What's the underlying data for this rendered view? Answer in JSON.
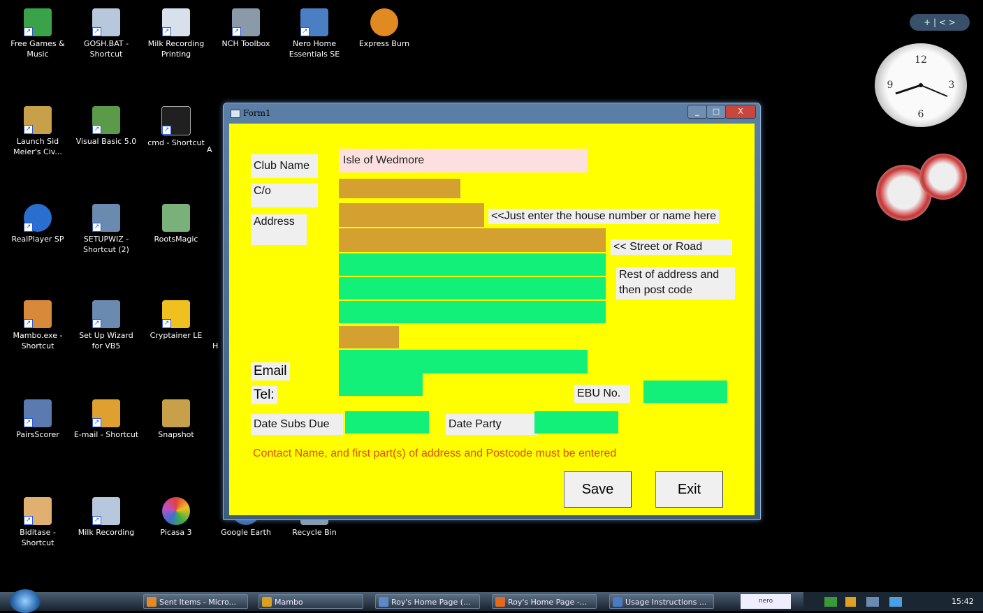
{
  "desktop_icons": [
    {
      "label": "Free Games & Music",
      "color": "#3aa34a"
    },
    {
      "label": "GOSH.BAT - Shortcut",
      "color": "#b8c8dc"
    },
    {
      "label": "Milk Recording Printing",
      "color": "#d8e0ec"
    },
    {
      "label": "NCH Toolbox",
      "color": "#8a9aa8"
    },
    {
      "label": "Nero Home Essentials SE",
      "color": "#4a7fc4"
    },
    {
      "label": "Express Burn",
      "color": "#e28a22"
    },
    {
      "label": "Launch Sid Meier's Civ...",
      "color": "#c9a04a"
    },
    {
      "label": "Visual Basic 5.0",
      "color": "#5a9a48"
    },
    {
      "label": "cmd - Shortcut",
      "color": "#202020"
    },
    {
      "label": "RealPlayer SP",
      "color": "#2a6fd0"
    },
    {
      "label": "SETUPWIZ - Shortcut (2)",
      "color": "#6a8ab0"
    },
    {
      "label": "RootsMagic",
      "color": "#7ab07a"
    },
    {
      "label": "Mambo.exe - Shortcut",
      "color": "#d88a3a"
    },
    {
      "label": "Set Up Wizard for VB5",
      "color": "#6a8ab0"
    },
    {
      "label": "Cryptainer LE",
      "color": "#f0c020"
    },
    {
      "label": "PairsScorer",
      "color": "#5a7ab0"
    },
    {
      "label": "E-mail - Shortcut",
      "color": "#e0a030"
    },
    {
      "label": "Snapshot",
      "color": "#c9a04a"
    },
    {
      "label": "Biditase - Shortcut",
      "color": "#e0b070"
    },
    {
      "label": "Milk Recording",
      "color": "#b8c8dc"
    },
    {
      "label": "Picasa 3",
      "color": "#c050c0"
    },
    {
      "label": "Google Earth",
      "color": "#3a6aa8"
    },
    {
      "label": "Recycle Bin",
      "color": "#8a9aa8"
    }
  ],
  "partial_icon_letters": {
    "a": "A",
    "b": "H"
  },
  "window": {
    "title": "Form1",
    "minimize": "_",
    "maximize": "□",
    "close": "X"
  },
  "form": {
    "club_name_label": "Club Name",
    "club_name_value": "Isle of Wedmore",
    "co_label": "C/o",
    "address_label": "Address",
    "hint_house": "<<Just enter the house number or name here",
    "hint_street": "<< Street or Road",
    "hint_rest": "Rest of address and then post code",
    "email_label": "Email",
    "tel_label": "Tel:",
    "ebu_label": "EBU No.",
    "date_subs_label": "Date Subs Due",
    "date_party_label": "Date Party",
    "warning": "Contact Name, and first part(s) of address and Postcode must be entered",
    "save_label": "Save",
    "exit_label": "Exit"
  },
  "colors": {
    "form_bg": "#ffff00",
    "field_tan": "#d4a030",
    "field_green": "#13f07a",
    "field_pink": "#fce0e0",
    "warning": "#e05000"
  },
  "gadgets": {
    "sidebar_control": "+ | < >"
  },
  "taskbar": {
    "items": [
      {
        "label": "Sent Items - Micro...",
        "color": "#e08a2a"
      },
      {
        "label": "Mambo",
        "color": "#d8a020"
      },
      {
        "label": "Roy's Home Page (...",
        "color": "#5a8ac8"
      },
      {
        "label": "Roy's Home Page -...",
        "color": "#e06a20"
      },
      {
        "label": "Usage Instructions ...",
        "color": "#4a7ac0"
      }
    ],
    "nero_label": "nero",
    "clock": "15:42"
  }
}
